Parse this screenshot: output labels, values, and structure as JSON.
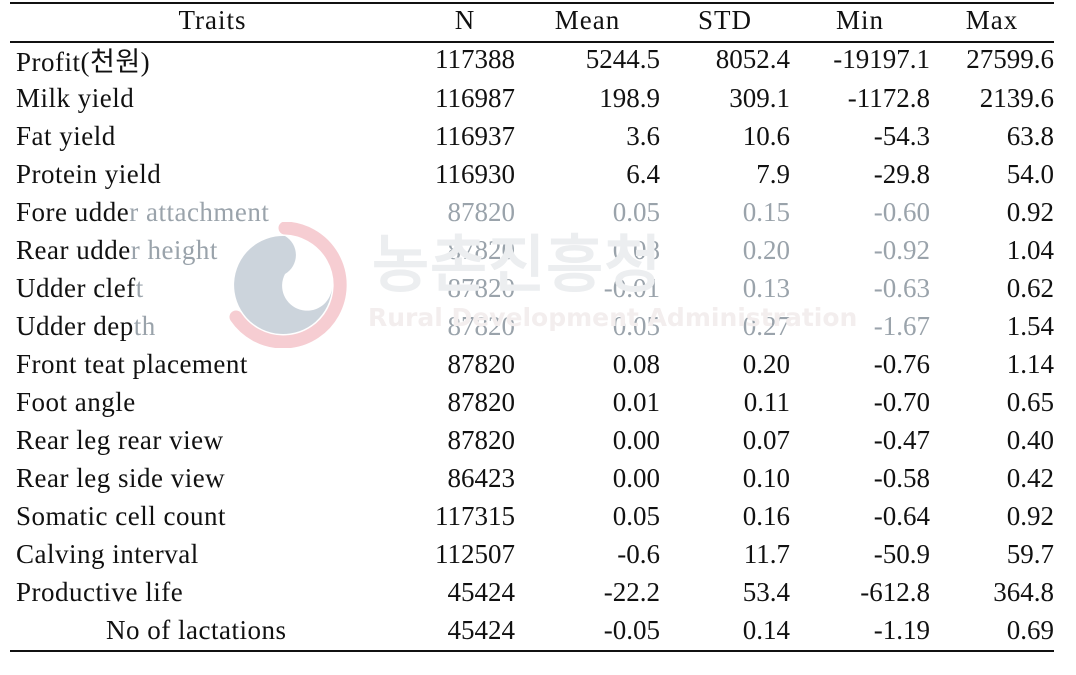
{
  "table": {
    "columns": [
      "Traits",
      "N",
      "Mean",
      "STD",
      "Min",
      "Max"
    ],
    "rows": [
      {
        "trait": "Profit(천원)",
        "lead": "",
        "tail": "",
        "n": "117388",
        "mean": "5244.5",
        "std": "8052.4",
        "min": "-19197.1",
        "max": "27599.6",
        "faded": false,
        "indent": false
      },
      {
        "trait": "Milk yield",
        "lead": "",
        "tail": "",
        "n": "116987",
        "mean": "198.9",
        "std": "309.1",
        "min": "-1172.8",
        "max": "2139.6",
        "faded": false,
        "indent": false
      },
      {
        "trait": "Fat yield",
        "lead": "",
        "tail": "",
        "n": "116937",
        "mean": "3.6",
        "std": "10.6",
        "min": "-54.3",
        "max": "63.8",
        "faded": false,
        "indent": false
      },
      {
        "trait": "Protein yield",
        "lead": "",
        "tail": "",
        "n": "116930",
        "mean": "6.4",
        "std": "7.9",
        "min": "-29.8",
        "max": "54.0",
        "faded": false,
        "indent": false
      },
      {
        "trait": "Fore udder attachment",
        "lead": "Fore udde",
        "tail": "r attachment",
        "n": "87820",
        "mean": "0.05",
        "std": "0.15",
        "min": "-0.60",
        "max": "0.92",
        "faded": true,
        "indent": false
      },
      {
        "trait": "Rear udder height",
        "lead": "Rear udde",
        "tail": "r height",
        "n": "87820",
        "mean": "0.08",
        "std": "0.20",
        "min": "-0.92",
        "max": "1.04",
        "faded": true,
        "indent": false
      },
      {
        "trait": "Udder cleft",
        "lead": "Udder clef",
        "tail": "t",
        "n": "87820",
        "mean": "-0.01",
        "std": "0.13",
        "min": "-0.63",
        "max": "0.62",
        "faded": true,
        "indent": false
      },
      {
        "trait": "Udder depth",
        "lead": "Udder dep",
        "tail": "th",
        "n": "87820",
        "mean": "0.05",
        "std": "0.27",
        "min": "-1.67",
        "max": "1.54",
        "faded": true,
        "indent": false
      },
      {
        "trait": "Front teat placement",
        "lead": "",
        "tail": "",
        "n": "87820",
        "mean": "0.08",
        "std": "0.20",
        "min": "-0.76",
        "max": "1.14",
        "faded": false,
        "indent": false
      },
      {
        "trait": "Foot angle",
        "lead": "",
        "tail": "",
        "n": "87820",
        "mean": "0.01",
        "std": "0.11",
        "min": "-0.70",
        "max": "0.65",
        "faded": false,
        "indent": false
      },
      {
        "trait": "Rear leg rear view",
        "lead": "",
        "tail": "",
        "n": "87820",
        "mean": "0.00",
        "std": "0.07",
        "min": "-0.47",
        "max": "0.40",
        "faded": false,
        "indent": false
      },
      {
        "trait": "Rear leg side view",
        "lead": "",
        "tail": "",
        "n": "86423",
        "mean": "0.00",
        "std": "0.10",
        "min": "-0.58",
        "max": "0.42",
        "faded": false,
        "indent": false
      },
      {
        "trait": "Somatic cell count",
        "lead": "",
        "tail": "",
        "n": "117315",
        "mean": "0.05",
        "std": "0.16",
        "min": "-0.64",
        "max": "0.92",
        "faded": false,
        "indent": false
      },
      {
        "trait": "Calving interval",
        "lead": "",
        "tail": "",
        "n": "112507",
        "mean": "-0.6",
        "std": "11.7",
        "min": "-50.9",
        "max": "59.7",
        "faded": false,
        "indent": false
      },
      {
        "trait": "Productive life",
        "lead": "",
        "tail": "",
        "n": "45424",
        "mean": "-22.2",
        "std": "53.4",
        "min": "-612.8",
        "max": "364.8",
        "faded": false,
        "indent": false
      },
      {
        "trait": "No of lactations",
        "lead": "",
        "tail": "",
        "n": "45424",
        "mean": "-0.05",
        "std": "0.14",
        "min": "-1.19",
        "max": "0.69",
        "faded": false,
        "indent": true
      }
    ]
  },
  "watermark": {
    "korean_text": "농촌진흥청",
    "english_text": "Rural Development Administration",
    "logo_name": "rural-development-administration-logo",
    "ring_color": "#f6cdd2",
    "swirl_color": "#ccd4dc",
    "korean_color": "#eceef0",
    "english_color": "#f3eeee"
  },
  "colors": {
    "text": "#111111",
    "faded_text": "#9aa3ab",
    "rule": "#111111",
    "background": "#ffffff"
  }
}
